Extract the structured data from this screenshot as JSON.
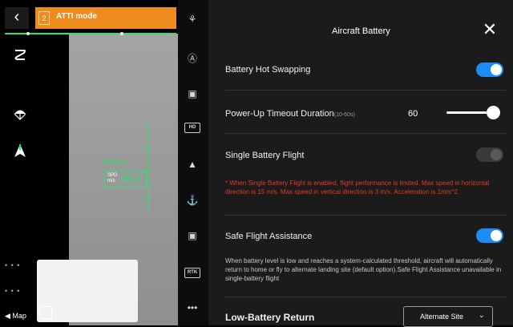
{
  "flight_view": {
    "back_icon": "chevron-left-icon",
    "mode_badge": "2",
    "mode_label": "ATTI mode",
    "wp_label": "WP:00.0",
    "speed_label_top": "SPD",
    "speed_label_bottom": "m/s",
    "speed_value": "00.0",
    "map_label": "Map",
    "left_dots": [
      "• • •",
      "• • •"
    ]
  },
  "side_icons": [
    "route-icon",
    "parachute-icon",
    "aircraft-icon"
  ],
  "mid_icons": [
    {
      "name": "drone-icon",
      "text": "⚘"
    },
    {
      "name": "auto-icon",
      "text": "Ⓐ"
    },
    {
      "name": "remote-controller-icon",
      "text": "▣"
    },
    {
      "name": "hd-icon",
      "text": "HD"
    },
    {
      "name": "aircraft-battery-icon",
      "text": "▲"
    },
    {
      "name": "gimbal-icon",
      "text": "⚓"
    },
    {
      "name": "camera-icon",
      "text": "▣"
    },
    {
      "name": "rtk-icon",
      "text": "RTK"
    },
    {
      "name": "more-icon",
      "text": "•••"
    }
  ],
  "panel": {
    "title": "Aircraft Battery",
    "rows": {
      "hot_swap": {
        "label": "Battery Hot Swapping",
        "on": true
      },
      "timeout": {
        "label": "Power-Up Timeout Duration",
        "range": "(10-60s)",
        "value": "60",
        "slider_fraction": 1.0
      },
      "single_battery": {
        "label": "Single Battery Flight",
        "on": false,
        "warning": "* When Single Battery Flight is enabled, flight performance is limited. Max speed in horizontal direction is 15 m/s. Max speed in vertical direction is 3 m/s. Acceleration is 1m/s^2"
      },
      "safe_flight": {
        "label": "Safe Flight Assistance",
        "on": true,
        "description": "When battery level is low and reaches a system-calculated threshold, aircraft will automatically return to home or fly to alternate landing site (default option).Safe Flight Assistance unavailable in single-battery flight"
      },
      "low_battery": {
        "label": "Low-Battery Return",
        "option": "Alternate Site"
      }
    }
  },
  "colors": {
    "accent": "#1e8cf7",
    "mode": "#ef8a1e",
    "hud_green": "#2ee36b",
    "warning": "#e23b2a"
  }
}
